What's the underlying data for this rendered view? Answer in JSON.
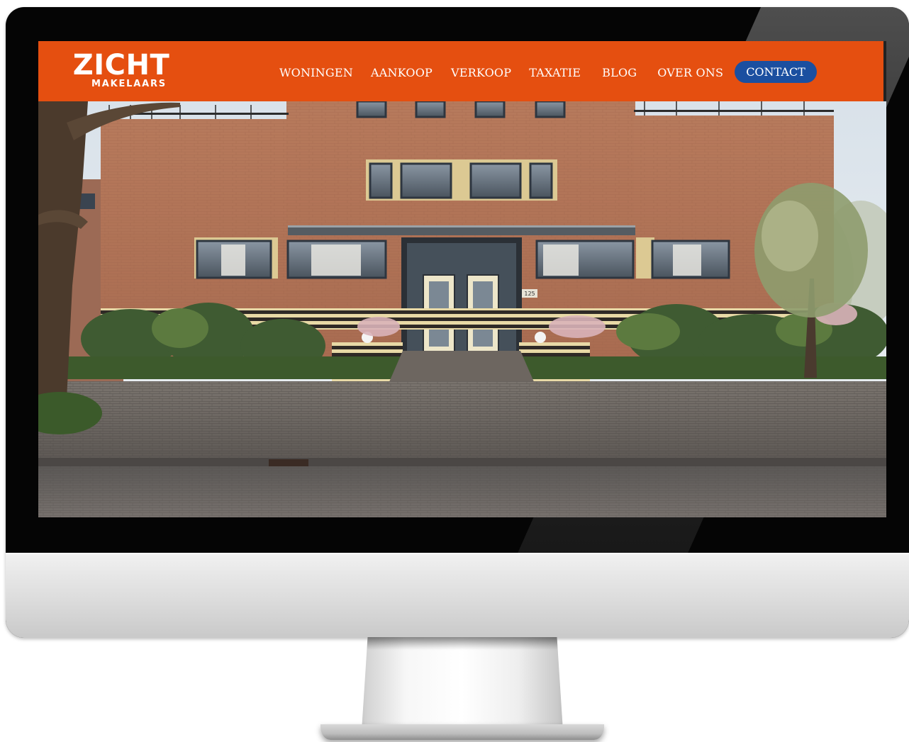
{
  "brand": {
    "name": "ZICHT",
    "tagline": "MAKELAARS",
    "color": "#e54f10"
  },
  "nav": {
    "items": [
      {
        "label": "WONINGEN"
      },
      {
        "label": "AANKOOP"
      },
      {
        "label": "VERKOOP"
      },
      {
        "label": "TAXATIE"
      },
      {
        "label": "BLOG"
      },
      {
        "label": "OVER ONS"
      }
    ],
    "contact_label": "CONTACT",
    "contact_color": "#1b4fa0"
  },
  "hero": {
    "house_number": "125"
  }
}
